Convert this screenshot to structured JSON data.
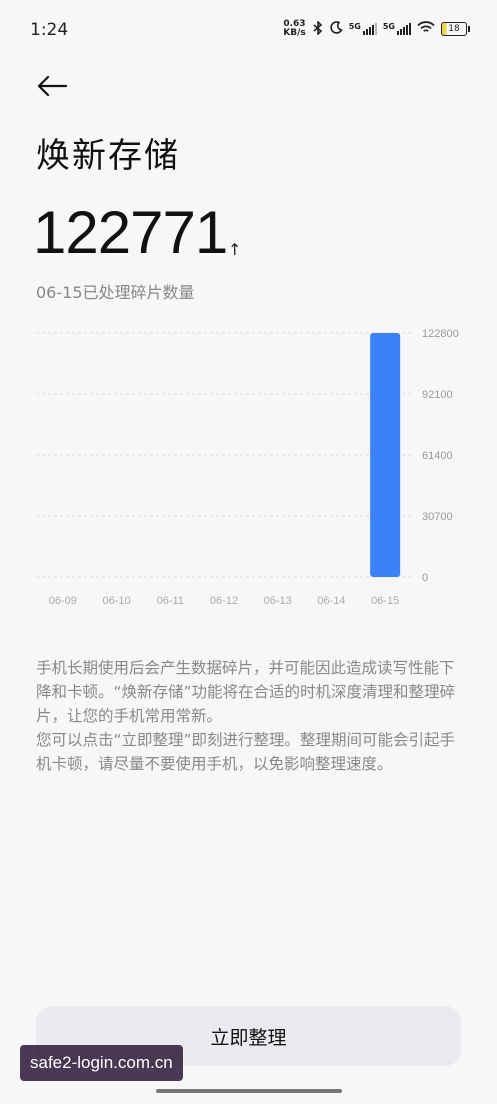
{
  "status_bar": {
    "time": "1:24",
    "net_speed_value": "0.63",
    "net_speed_unit": "KB/s",
    "sim1_label": "5G",
    "sim2_label": "5G",
    "battery_level": "18"
  },
  "header": {
    "title": "焕新存储"
  },
  "summary": {
    "count": "122771",
    "arrow": "↑",
    "caption": "06-15已处理碎片数量"
  },
  "chart_data": {
    "type": "bar",
    "categories": [
      "06-09",
      "06-10",
      "06-11",
      "06-12",
      "06-13",
      "06-14",
      "06-15"
    ],
    "values": [
      0,
      0,
      0,
      0,
      0,
      0,
      122771
    ],
    "y_ticks": [
      0,
      30700,
      61400,
      92100,
      122800
    ],
    "ylim": [
      0,
      122800
    ],
    "bar_color": "#3b82f6",
    "grid": "dashed horizontal",
    "y_axis_position": "right"
  },
  "description": {
    "line1": "手机长期使用后会产生数据碎片，并可能因此造成读写性能下降和卡顿。“焕新存储”功能将在合适的时机深度清理和整理碎片，让您的手机常用常新。",
    "line2": "您可以点击“立即整理”即刻进行整理。整理期间可能会引起手机卡顿，请尽量不要使用手机，以免影响整理速度。"
  },
  "actions": {
    "primary_label": "立即整理"
  },
  "watermark": {
    "text": "safe2-login.com.cn"
  }
}
